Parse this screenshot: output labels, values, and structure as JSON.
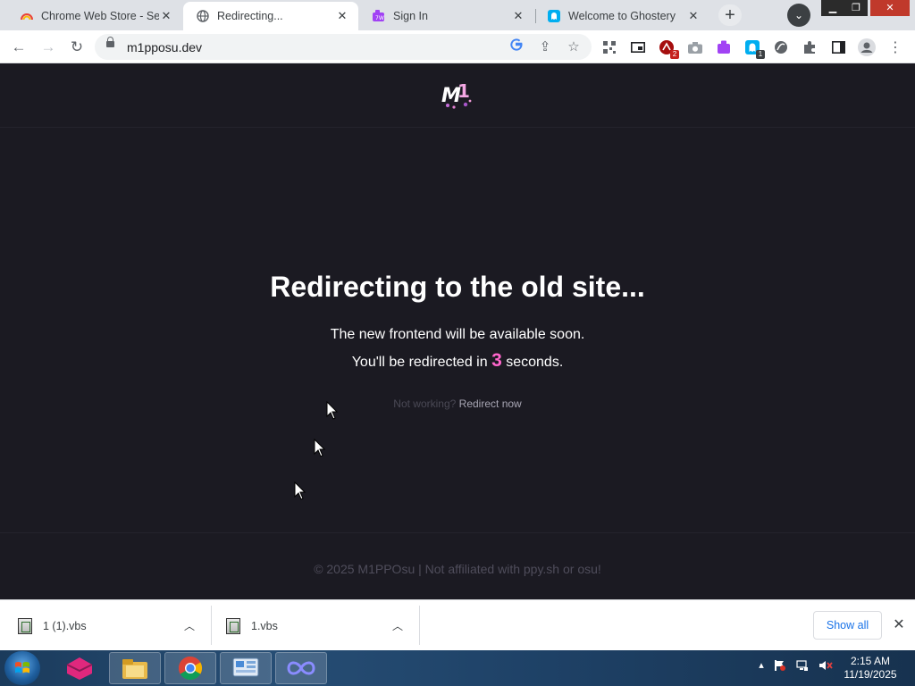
{
  "browser": {
    "tabs": [
      {
        "title": "Chrome Web Store - Sea",
        "active": false,
        "favicon": "rainbow-icon"
      },
      {
        "title": "Redirecting...",
        "active": true,
        "favicon": "globe-icon"
      },
      {
        "title": "Sign In",
        "active": false,
        "favicon": "puzzle-icon"
      },
      {
        "title": "Welcome to Ghostery",
        "active": false,
        "favicon": "ghostery-icon"
      }
    ],
    "url": "m1pposu.dev",
    "extension_badges": {
      "ext_red": "2",
      "ext_teal": "1"
    }
  },
  "page": {
    "headline": "Redirecting to the old site...",
    "subline": "The new frontend will be available soon.",
    "count_prefix": "You'll be redirected in",
    "count_value": "3",
    "count_suffix": "seconds.",
    "not_working": "Not working?",
    "redirect_now": "Redirect now",
    "footer": "© 2025 M1PPOsu  | Not affiliated with ppy.sh or osu!",
    "accent_color": "#ff66cc",
    "background_color": "#1b1a22"
  },
  "downloads": {
    "items": [
      {
        "name": "1 (1).vbs"
      },
      {
        "name": "1.vbs"
      }
    ],
    "show_all": "Show all"
  },
  "taskbar": {
    "time": "2:15 AM",
    "date": "11/19/2025"
  }
}
